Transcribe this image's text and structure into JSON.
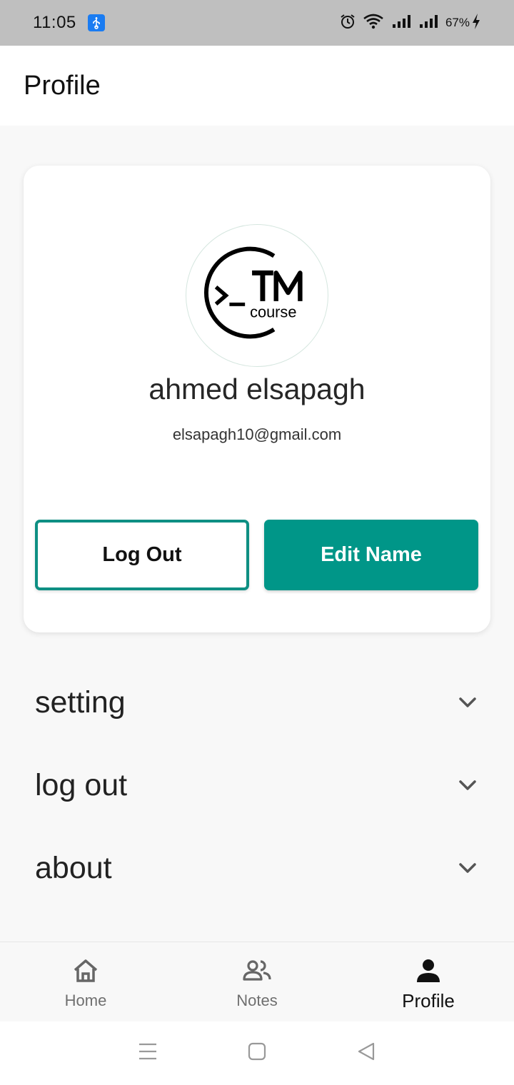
{
  "status_bar": {
    "time": "11:05",
    "battery": "67%",
    "icons": [
      "usb-icon",
      "alarm-icon",
      "wifi-icon",
      "signal-icon",
      "signal-icon",
      "charging-icon"
    ]
  },
  "app_bar": {
    "title": "Profile"
  },
  "profile": {
    "avatar_logo_text": "TM course",
    "name": "ahmed elsapagh",
    "email": "elsapagh10@gmail.com",
    "logout_label": "Log Out",
    "edit_label": "Edit Name"
  },
  "expand_list": {
    "items": [
      {
        "label": "setting"
      },
      {
        "label": "log out"
      },
      {
        "label": "about"
      }
    ]
  },
  "bottom_nav": {
    "items": [
      {
        "label": "Home",
        "icon": "home-icon",
        "active": false
      },
      {
        "label": "Notes",
        "icon": "people-icon",
        "active": false
      },
      {
        "label": "Profile",
        "icon": "person-icon",
        "active": true
      }
    ]
  },
  "colors": {
    "accent": "#009688",
    "status_bar": "#bfbfbf",
    "background": "#f8f8f8"
  }
}
